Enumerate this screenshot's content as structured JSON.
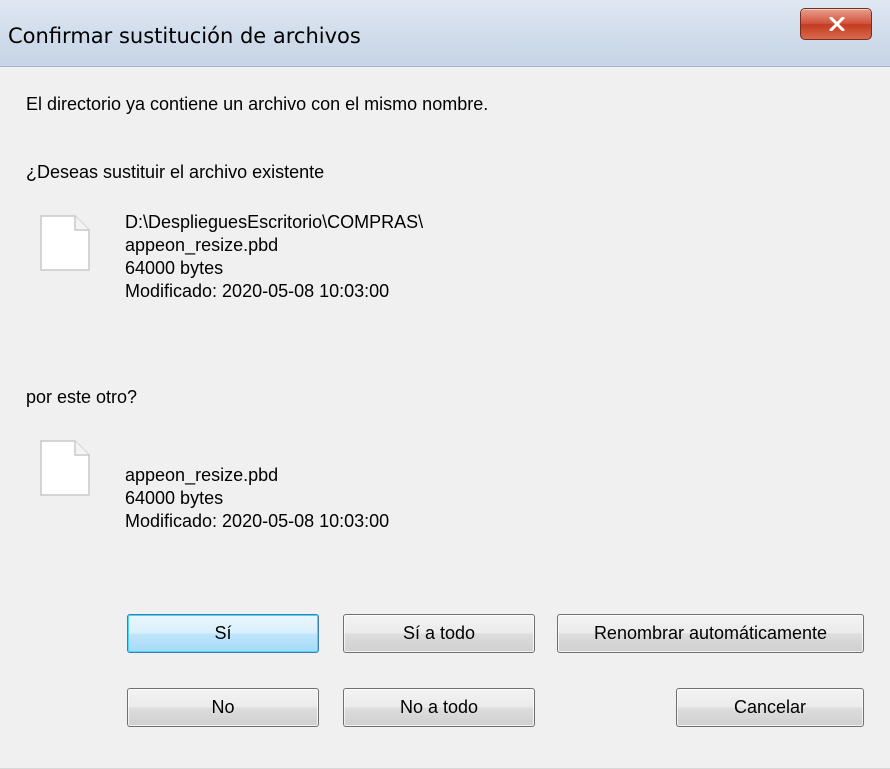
{
  "window": {
    "title": "Confirmar sustitución de archivos"
  },
  "message": {
    "line1": "El directorio ya contiene un archivo con el mismo nombre.",
    "question": "¿Deseas sustituir el archivo existente",
    "replace_with": "por este otro?"
  },
  "existing_file": {
    "path": "D:\\DesplieguesEscritorio\\COMPRAS\\",
    "name": "appeon_resize.pbd",
    "size": "64000 bytes",
    "modified": "Modificado: 2020-05-08 10:03:00"
  },
  "new_file": {
    "name": "appeon_resize.pbd",
    "size": "64000 bytes",
    "modified": "Modificado: 2020-05-08 10:03:00"
  },
  "buttons": {
    "yes": "Sí",
    "yes_all": "Sí a todo",
    "auto_rename": "Renombrar automáticamente",
    "no": "No",
    "no_all": "No a todo",
    "cancel": "Cancelar"
  },
  "icons": {
    "close": "close-icon",
    "file": "file-icon"
  },
  "colors": {
    "close_button": "#c43b20",
    "default_button_border": "#3c7fb1",
    "dialog_background": "#f0f0f0"
  }
}
